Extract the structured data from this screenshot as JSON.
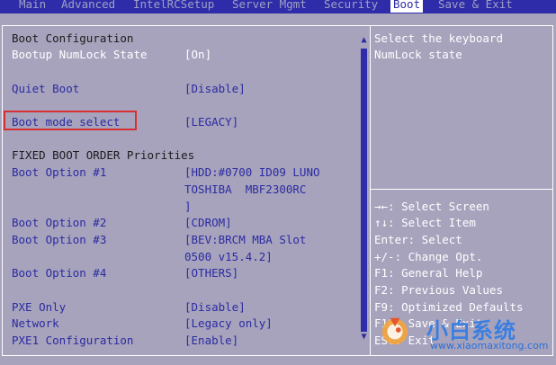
{
  "menu": {
    "tabs": [
      {
        "label": "Main"
      },
      {
        "label": "Advanced"
      },
      {
        "label": "IntelRCSetup"
      },
      {
        "label": "Server Mgmt"
      },
      {
        "label": "Security"
      },
      {
        "label": "Boot"
      },
      {
        "label": "Save & Exit"
      }
    ],
    "active_tab": "Boot"
  },
  "settings": {
    "boot_config_header": "Boot Configuration",
    "numlock": {
      "label": "Bootup NumLock State",
      "value": "[On]"
    },
    "quiet_boot": {
      "label": "Quiet Boot",
      "value": "[Disable]"
    },
    "boot_mode": {
      "label": "Boot mode select",
      "value": "[LEGACY]"
    },
    "fixed_order_header": "FIXED BOOT ORDER Priorities",
    "option1": {
      "label": "Boot Option #1",
      "value_lines": [
        "[HDD:#0700 ID09 LUNO",
        "TOSHIBA  MBF2300RC",
        "]"
      ]
    },
    "option2": {
      "label": "Boot Option #2",
      "value": "[CDROM]"
    },
    "option3": {
      "label": "Boot Option #3",
      "value_lines": [
        "[BEV:BRCM MBA Slot",
        "0500 v15.4.2]"
      ]
    },
    "option4": {
      "label": "Boot Option #4",
      "value": "[OTHERS]"
    },
    "pxe_only": {
      "label": "PXE Only",
      "value": "[Disable]"
    },
    "network": {
      "label": "Network",
      "value": "[Legacy only]"
    },
    "pxe1": {
      "label": "PXE1 Configuration",
      "value": "[Enable]"
    }
  },
  "help": {
    "lines": [
      "Select the keyboard",
      "NumLock state"
    ]
  },
  "keys": {
    "lines": [
      "→←: Select Screen",
      "↑↓: Select Item",
      "Enter: Select",
      "+/-: Change Opt.",
      "F1: General Help",
      "F2: Previous Values",
      "F9: Optimized Defaults",
      "F10: Save & Exit",
      "ESC: Exit"
    ]
  },
  "scrollbar": {
    "up": "▲",
    "down": "▼"
  },
  "watermark": {
    "title": "小白系统",
    "url": "www.xiaomaxitong.com"
  },
  "colors": {
    "menubar": "#2e2ca8",
    "background": "#a7a3bd",
    "label": "#2b2ba0",
    "highlight_box": "#d63030"
  }
}
